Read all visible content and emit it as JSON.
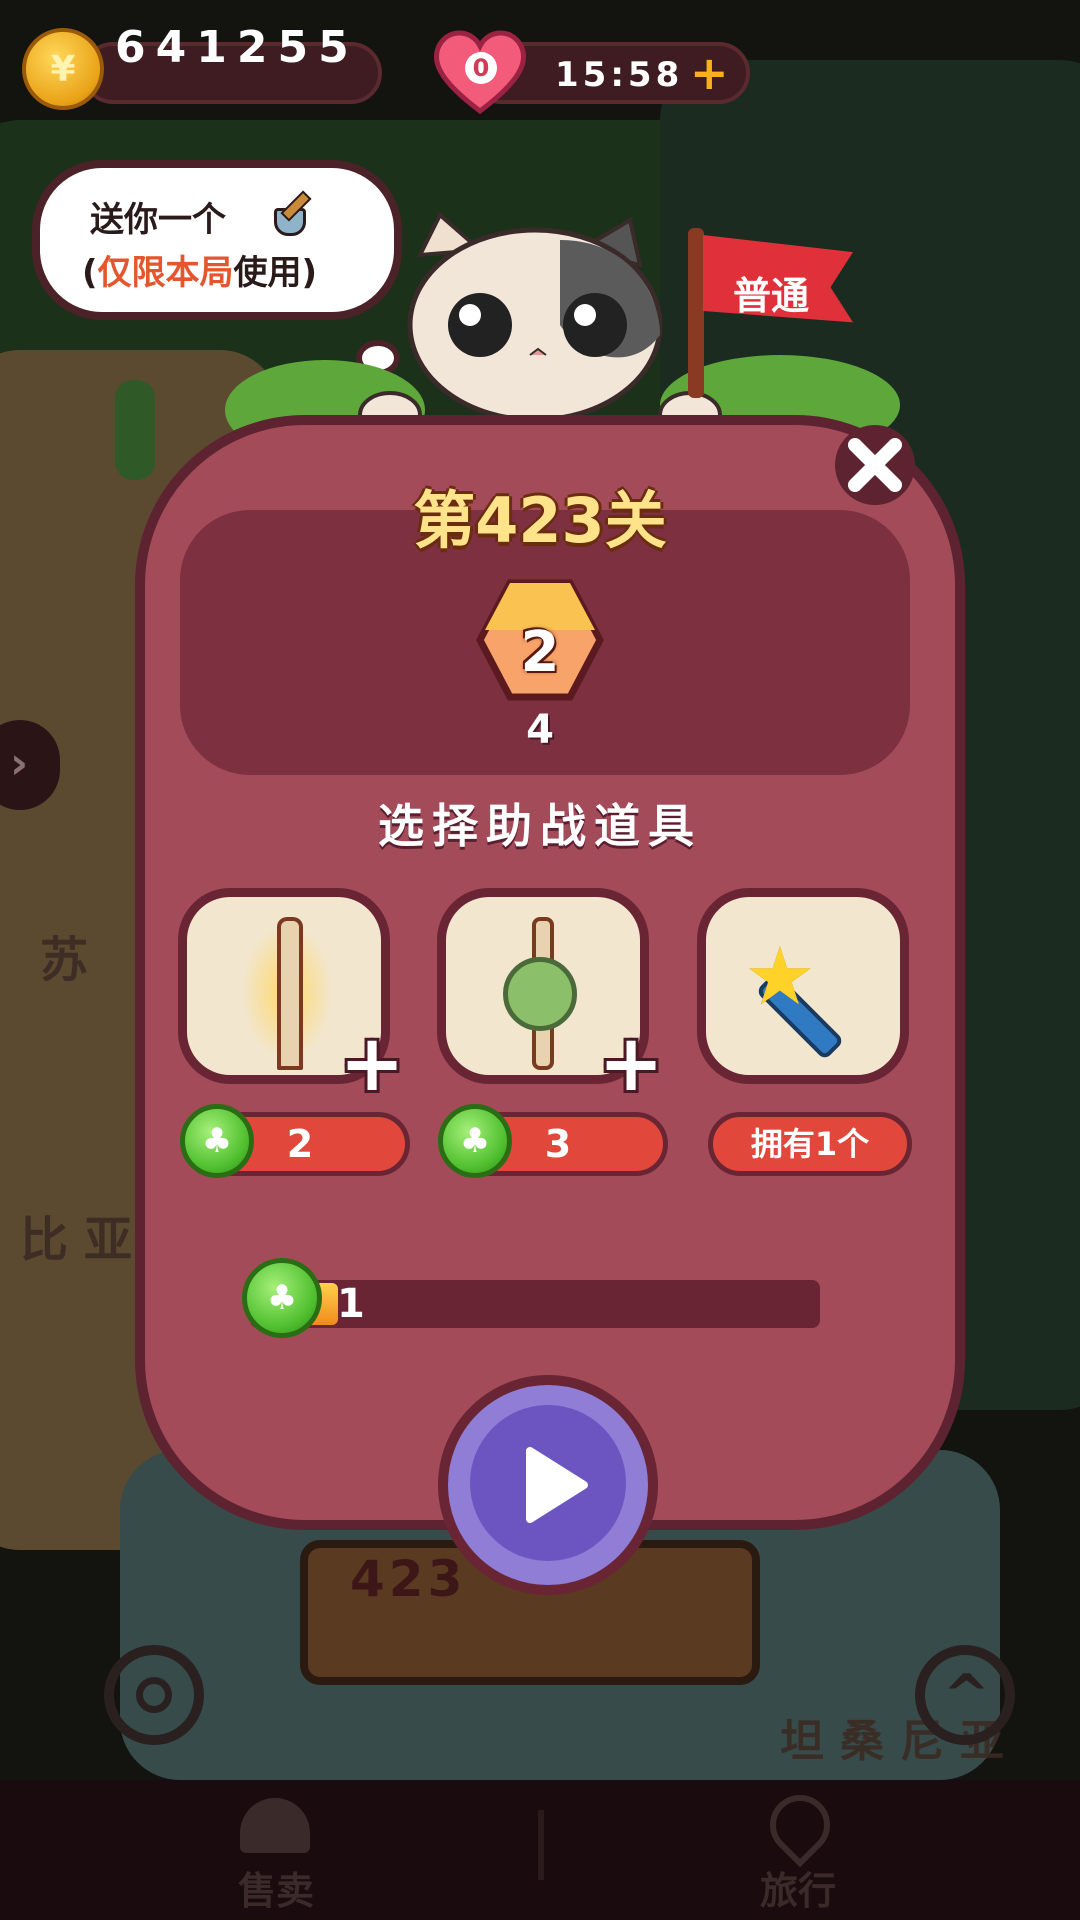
{
  "top_bar": {
    "coins": "641255",
    "coin_icon": "yen-coin-icon",
    "coin_symbol": "¥",
    "lives": "0",
    "timer": "15:58",
    "add_symbol": "+"
  },
  "bubble": {
    "line1": "送你一个",
    "line2_open": "(",
    "line2_highlight": "仅限本局",
    "line2_rest": "使用)",
    "gift_icon": "shovel-icon"
  },
  "difficulty_flag": "普通",
  "level": {
    "title": "第423关",
    "goal_count": "2",
    "goal_sub": "4",
    "goal_icon": "cake-block-icon"
  },
  "section_title": "选择助战道具",
  "items": [
    {
      "name": "light-stick-icon",
      "price": "2",
      "has_plus": true
    },
    {
      "name": "grass-stick-icon",
      "price": "3",
      "has_plus": true
    },
    {
      "name": "magic-wand-icon",
      "price": "拥有1个",
      "has_plus": false
    }
  ],
  "clover_progress": {
    "value": "1",
    "fraction": 0.12
  },
  "map_labels": {
    "left_1": "苏",
    "left_2": "比亚",
    "sign": "423",
    "right_bottom": "坦桑尼亚"
  },
  "bottom_nav": {
    "sell": "售卖",
    "travel": "旅行"
  },
  "colors": {
    "panel": "#a34b59",
    "panel_border": "#5e2330",
    "title_yellow": "#ffe38a",
    "price_red": "#e2473b",
    "clover_green": "#4fbf2e",
    "play_purple": "#6c55c1"
  }
}
